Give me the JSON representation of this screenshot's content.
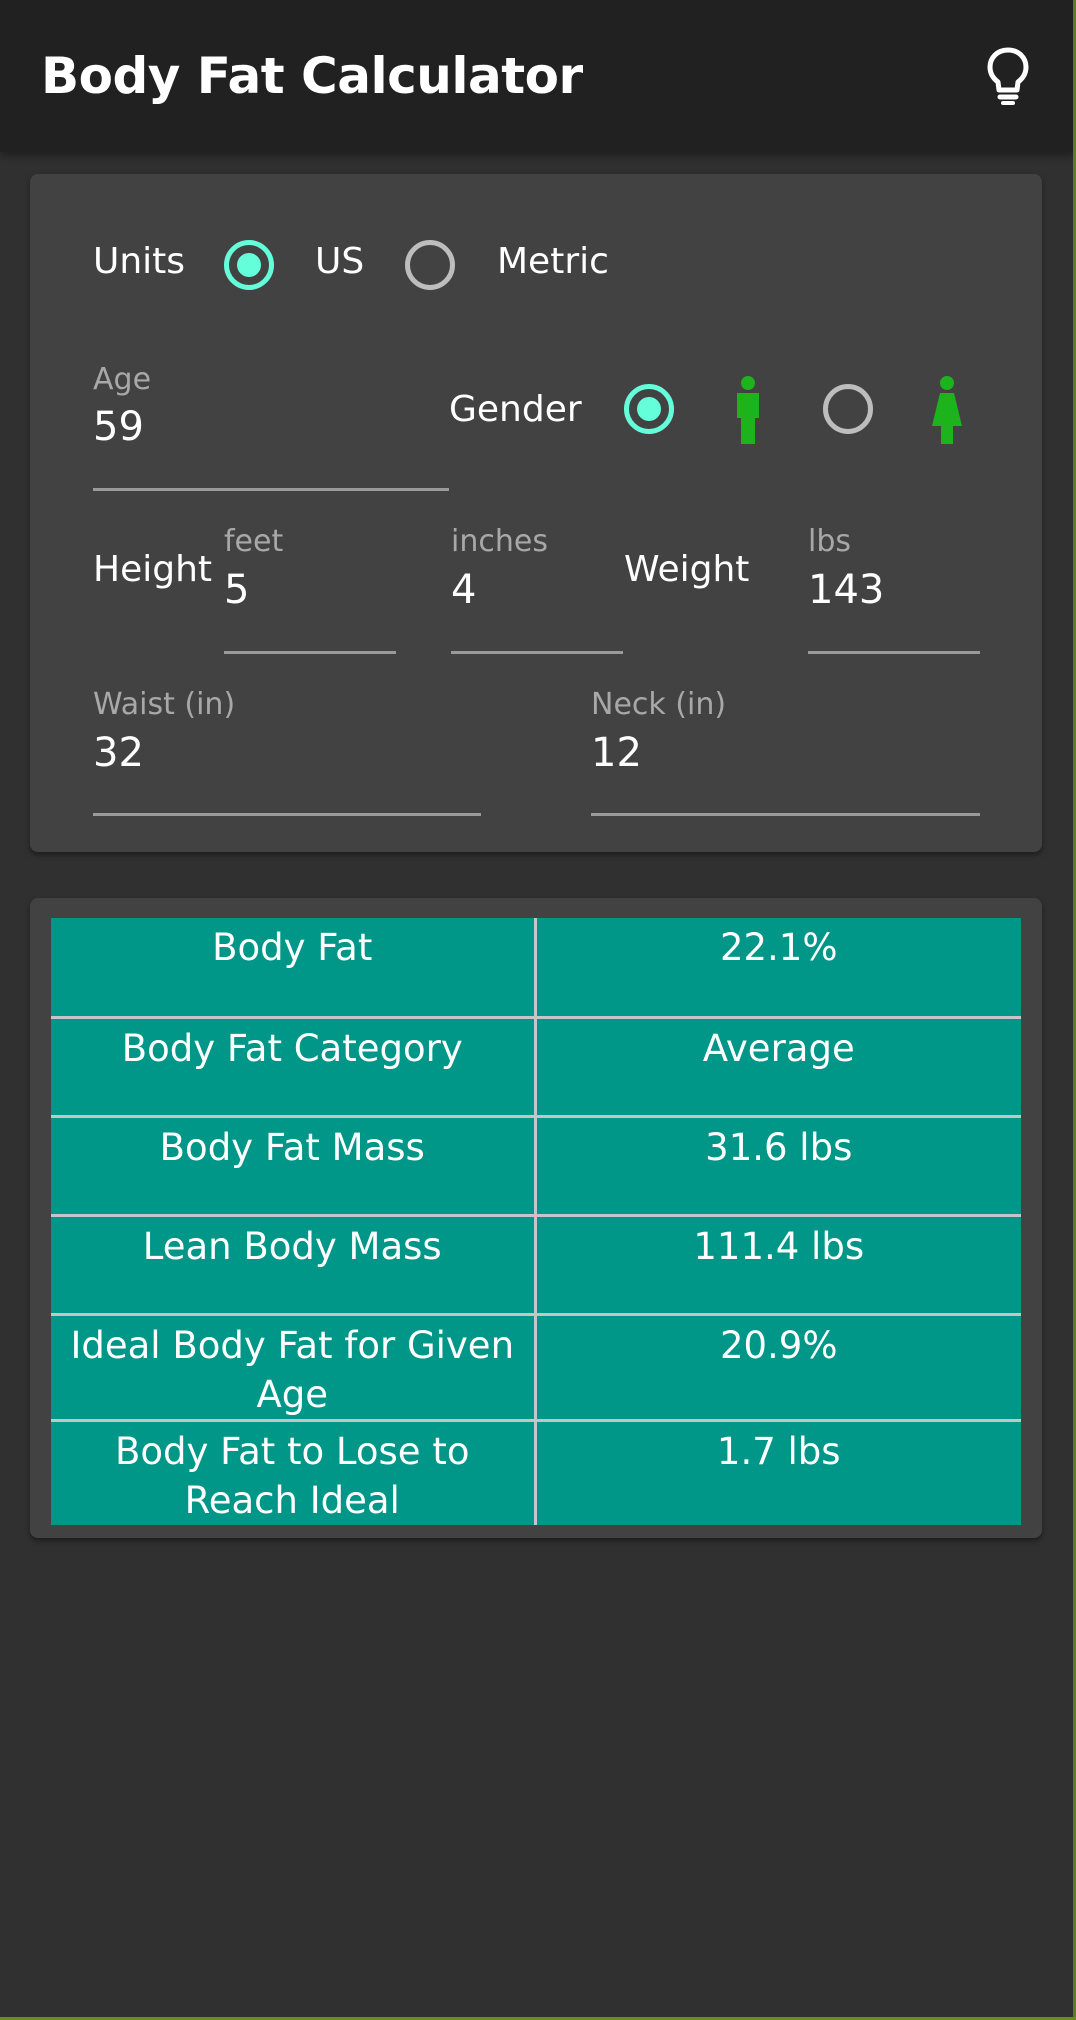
{
  "app_bar": {
    "title": "Body Fat Calculator",
    "action_icon": "lightbulb-icon"
  },
  "units": {
    "label": "Units",
    "options": [
      {
        "label": "US",
        "selected": true
      },
      {
        "label": "Metric",
        "selected": false
      }
    ]
  },
  "age": {
    "hint": "Age",
    "value": "59"
  },
  "gender": {
    "label": "Gender",
    "options": [
      {
        "icon": "male-icon",
        "selected": true
      },
      {
        "icon": "female-icon",
        "selected": false
      }
    ]
  },
  "height": {
    "label": "Height",
    "feet_hint": "feet",
    "feet_value": "5",
    "inches_hint": "inches",
    "inches_value": "4"
  },
  "weight": {
    "label": "Weight",
    "hint": "lbs",
    "value": "143"
  },
  "waist": {
    "hint": "Waist (in)",
    "value": "32"
  },
  "neck": {
    "hint": "Neck (in)",
    "value": "12"
  },
  "results": {
    "rows": [
      {
        "label": "Body Fat",
        "value": "22.1%"
      },
      {
        "label": "Body Fat Category",
        "value": "Average"
      },
      {
        "label": "Body Fat Mass",
        "value": "31.6 lbs"
      },
      {
        "label": "Lean Body Mass",
        "value": "111.4 lbs"
      },
      {
        "label": "Ideal Body Fat for Given Age",
        "value": "20.9%"
      },
      {
        "label": "Body Fat to Lose to Reach Ideal",
        "value": "1.7 lbs"
      }
    ]
  },
  "colors": {
    "accent": "#64ffda",
    "table_bg": "#009688",
    "gender_icon": "#1db31d",
    "app_bar_bg": "#212121",
    "card_bg": "#424242",
    "page_bg": "#303030"
  }
}
